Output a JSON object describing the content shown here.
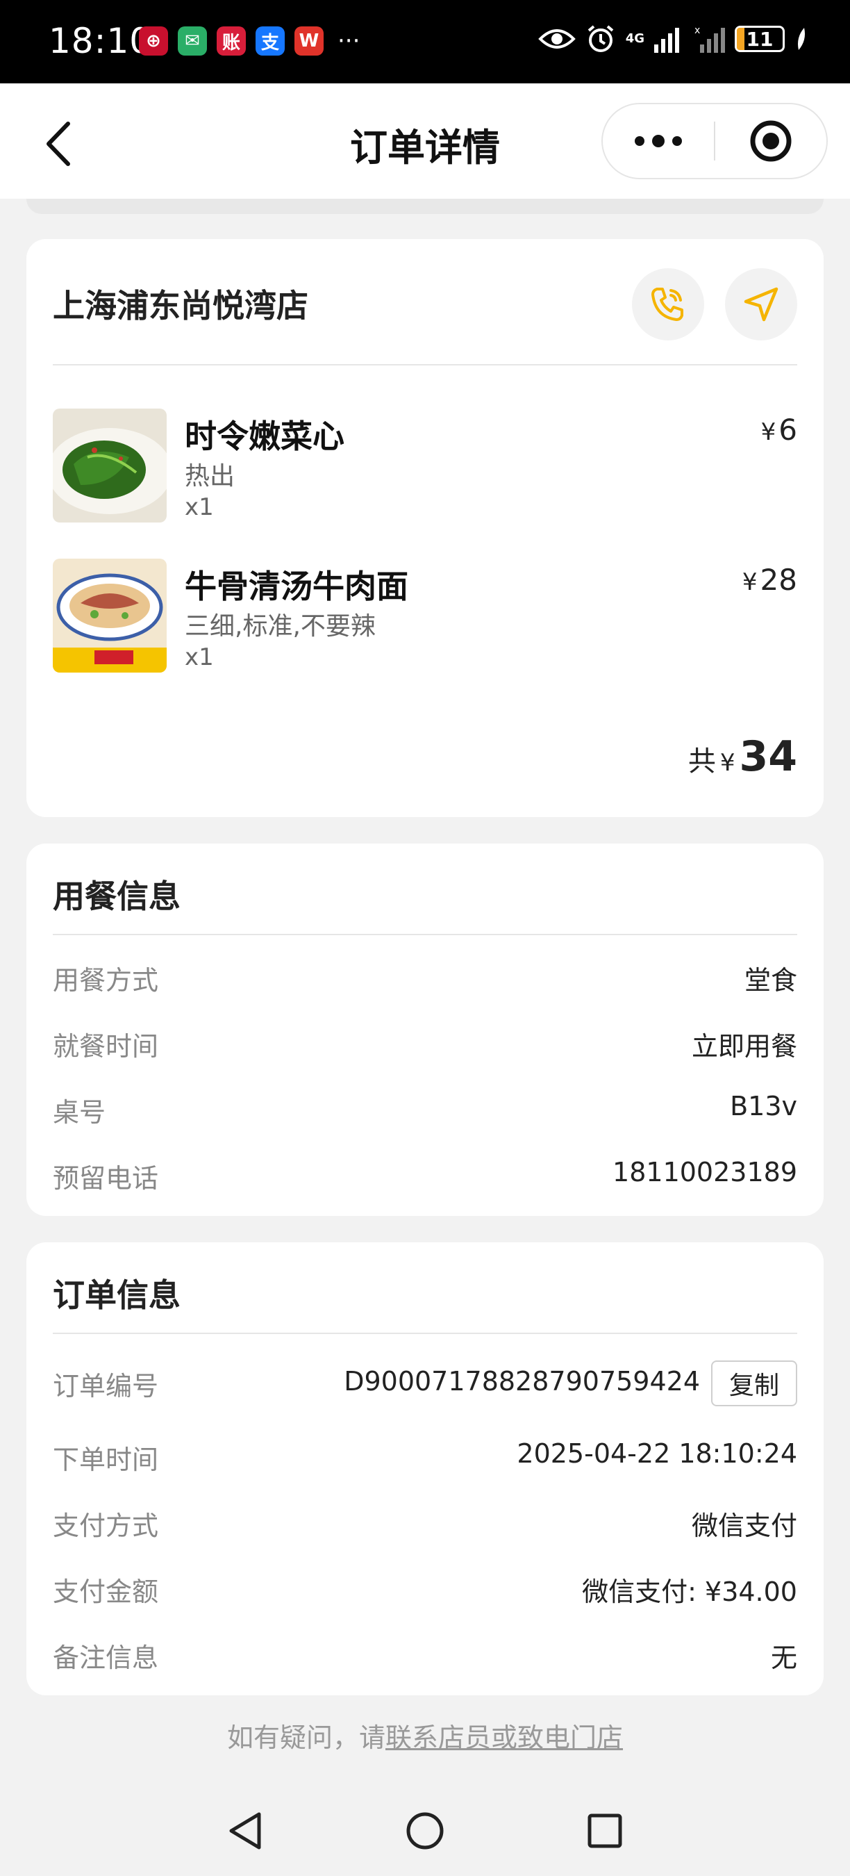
{
  "status_bar": {
    "time": "18:10",
    "network": "4G",
    "battery": "11",
    "apps": [
      {
        "icon": "bank-app-icon",
        "glyph": "⊕",
        "color": "#c8102e"
      },
      {
        "icon": "wechat-icon",
        "glyph": "✉",
        "color": "#2aae67"
      },
      {
        "icon": "jiazhang-app-icon",
        "glyph": "账",
        "color": "#d81e3a"
      },
      {
        "icon": "alipay-icon",
        "glyph": "支",
        "color": "#1677ff"
      },
      {
        "icon": "wps-icon",
        "glyph": "W",
        "color": "#e0332a"
      }
    ],
    "more": "···"
  },
  "nav": {
    "title": "订单详情"
  },
  "store": {
    "name": "上海浦东尚悦湾店",
    "accent_color": "#f5b400",
    "items": [
      {
        "name": "时令嫩菜心",
        "spec": "热出",
        "qty": "x1",
        "currency": "¥",
        "price": "6"
      },
      {
        "name": "牛骨清汤牛肉面",
        "spec": "三细,标准,不要辣",
        "qty": "x1",
        "currency": "¥",
        "price": "28"
      }
    ],
    "total_label": "共",
    "total_currency": "¥",
    "total_amount": "34"
  },
  "dining": {
    "title": "用餐信息",
    "rows": [
      {
        "label": "用餐方式",
        "value": "堂食"
      },
      {
        "label": "就餐时间",
        "value": "立即用餐"
      },
      {
        "label": "桌号",
        "value": "B13v"
      },
      {
        "label": "预留电话",
        "value": "18110023189"
      }
    ]
  },
  "order": {
    "title": "订单信息",
    "order_no_label": "订单编号",
    "order_no": "D90007178828790759424",
    "copy_label": "复制",
    "rows": [
      {
        "label": "下单时间",
        "value": "2025-04-22 18:10:24"
      },
      {
        "label": "支付方式",
        "value": "微信支付"
      },
      {
        "label": "支付金额",
        "value": "微信支付: ¥34.00"
      },
      {
        "label": "备注信息",
        "value": "无"
      }
    ]
  },
  "footer": {
    "prefix": "如有疑问，请",
    "link": "联系店员或致电门店"
  }
}
